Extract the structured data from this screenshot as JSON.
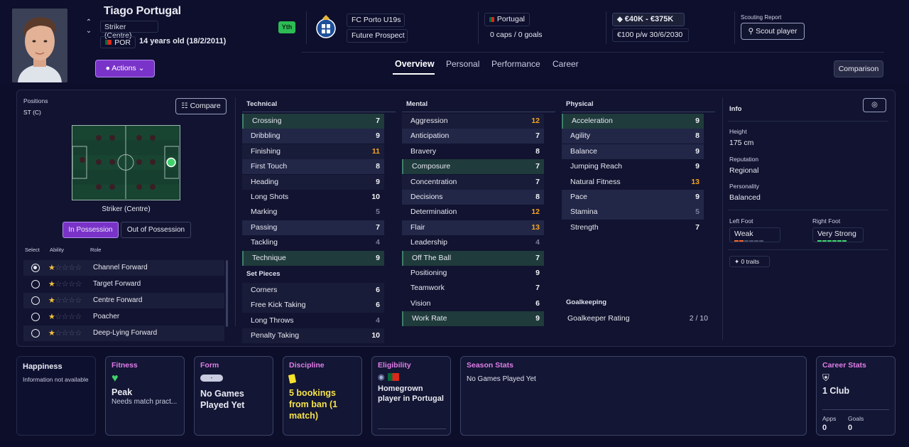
{
  "player": {
    "name": "Tiago Portugal",
    "position": "Striker (Centre)",
    "nationality_code": "POR",
    "age": "14 years old (18/2/2011)",
    "youth_badge": "Yth"
  },
  "club": {
    "name": "FC Porto U19s",
    "status": "Future Prospect"
  },
  "nation": {
    "name": "Portugal",
    "caps": "0 caps / 0 goals"
  },
  "contract": {
    "value": "€40K - €375K",
    "wage": "€100 p/w",
    "expiry": "30/6/2030"
  },
  "scouting": {
    "label": "Scouting Report",
    "button": "Scout player"
  },
  "actions_label": "Actions",
  "tabs": [
    "Overview",
    "Personal",
    "Performance",
    "Career"
  ],
  "comparison_label": "Comparison",
  "positions": {
    "label": "Positions",
    "value": "ST (C)",
    "compare_label": "Compare",
    "pitch_label": "Striker (Centre)",
    "in_possession": "In Possession",
    "out_possession": "Out of Possession",
    "headers": {
      "select": "Select",
      "ability": "Ability",
      "role": "Role"
    },
    "roles": [
      {
        "name": "Channel Forward",
        "stars": 1,
        "selected": true
      },
      {
        "name": "Target Forward",
        "stars": 1,
        "selected": false
      },
      {
        "name": "Centre Forward",
        "stars": 1,
        "selected": false
      },
      {
        "name": "Poacher",
        "stars": 1,
        "selected": false
      },
      {
        "name": "Deep-Lying Forward",
        "stars": 1,
        "selected": false
      }
    ]
  },
  "technical": {
    "title": "Technical",
    "items": [
      {
        "name": "Crossing",
        "value": "7"
      },
      {
        "name": "Dribbling",
        "value": "9"
      },
      {
        "name": "Finishing",
        "value": "11"
      },
      {
        "name": "First Touch",
        "value": "8"
      },
      {
        "name": "Heading",
        "value": "9"
      },
      {
        "name": "Long Shots",
        "value": "10"
      },
      {
        "name": "Marking",
        "value": "5"
      },
      {
        "name": "Passing",
        "value": "7"
      },
      {
        "name": "Tackling",
        "value": "4"
      },
      {
        "name": "Technique",
        "value": "9"
      }
    ]
  },
  "set_pieces": {
    "title": "Set Pieces",
    "items": [
      {
        "name": "Corners",
        "value": "6"
      },
      {
        "name": "Free Kick Taking",
        "value": "6"
      },
      {
        "name": "Long Throws",
        "value": "4"
      },
      {
        "name": "Penalty Taking",
        "value": "10"
      }
    ]
  },
  "mental": {
    "title": "Mental",
    "items": [
      {
        "name": "Aggression",
        "value": "12"
      },
      {
        "name": "Anticipation",
        "value": "7"
      },
      {
        "name": "Bravery",
        "value": "8"
      },
      {
        "name": "Composure",
        "value": "7"
      },
      {
        "name": "Concentration",
        "value": "7"
      },
      {
        "name": "Decisions",
        "value": "8"
      },
      {
        "name": "Determination",
        "value": "12"
      },
      {
        "name": "Flair",
        "value": "13"
      },
      {
        "name": "Leadership",
        "value": "4"
      },
      {
        "name": "Off The Ball",
        "value": "7"
      },
      {
        "name": "Positioning",
        "value": "9"
      },
      {
        "name": "Teamwork",
        "value": "7"
      },
      {
        "name": "Vision",
        "value": "6"
      },
      {
        "name": "Work Rate",
        "value": "9"
      }
    ]
  },
  "physical": {
    "title": "Physical",
    "items": [
      {
        "name": "Acceleration",
        "value": "9"
      },
      {
        "name": "Agility",
        "value": "8"
      },
      {
        "name": "Balance",
        "value": "9"
      },
      {
        "name": "Jumping Reach",
        "value": "9"
      },
      {
        "name": "Natural Fitness",
        "value": "13"
      },
      {
        "name": "Pace",
        "value": "9"
      },
      {
        "name": "Stamina",
        "value": "5"
      },
      {
        "name": "Strength",
        "value": "7"
      }
    ]
  },
  "goalkeeping": {
    "title": "Goalkeeping",
    "rating_label": "Goalkeeper Rating",
    "rating_value": "2 / 10"
  },
  "info": {
    "title": "Info",
    "height_label": "Height",
    "height": "175 cm",
    "reputation_label": "Reputation",
    "reputation": "Regional",
    "personality_label": "Personality",
    "personality": "Balanced",
    "left_foot_label": "Left Foot",
    "left_foot": "Weak",
    "right_foot_label": "Right Foot",
    "right_foot": "Very Strong",
    "traits": "0 traits"
  },
  "cards": {
    "happiness": {
      "title": "Happiness",
      "text": "Information not available"
    },
    "fitness": {
      "title": "Fitness",
      "value": "Peak",
      "sub": "Needs match pract..."
    },
    "form": {
      "title": "Form",
      "pill": "-",
      "value": "No Games Played Yet"
    },
    "discipline": {
      "title": "Discipline",
      "value": "5 bookings from ban (1 match)"
    },
    "eligibility": {
      "title": "Eligibility",
      "value": "Homegrown player in Portugal"
    },
    "season": {
      "title": "Season Stats",
      "text": "No Games Played Yet"
    },
    "career": {
      "title": "Career Stats",
      "value": "1 Club",
      "apps_label": "Apps",
      "apps": "0",
      "goals_label": "Goals",
      "goals": "0"
    }
  },
  "colors": {
    "accent": "#7a33c9",
    "highlight": "#f5a524",
    "green": "#2dbb54",
    "title_pink": "#e07ee8"
  }
}
